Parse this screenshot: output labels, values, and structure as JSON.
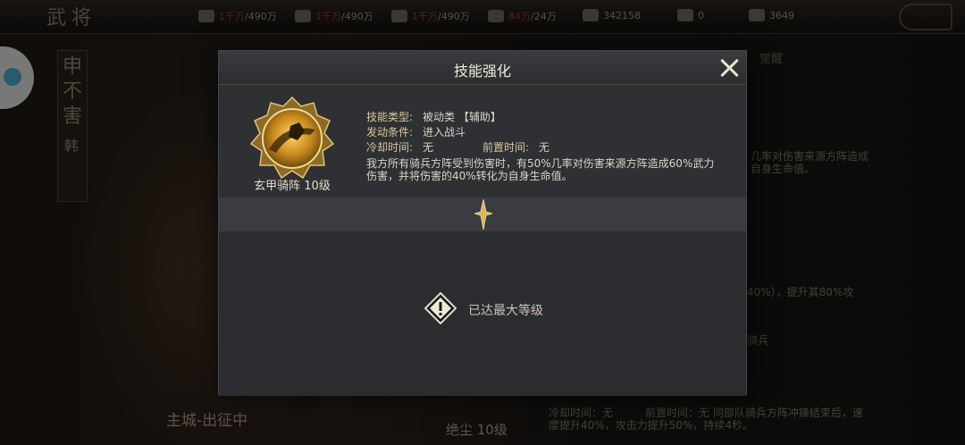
{
  "topbar": {
    "title": "武将",
    "resources": [
      {
        "icon": "grain-icon",
        "current": "1千万",
        "max": "/490万",
        "current_color": "#b0342a"
      },
      {
        "icon": "wood-icon",
        "current": "1千万",
        "max": "/490万",
        "current_color": "#b0342a"
      },
      {
        "icon": "stone-icon",
        "current": "1千万",
        "max": "/490万",
        "current_color": "#b0342a"
      },
      {
        "icon": "iron-icon",
        "current": "84万",
        "max": "/24万",
        "current_color": "#b0342a"
      },
      {
        "icon": "order-icon",
        "current": "",
        "max": "342158",
        "current_color": "#9a9488"
      },
      {
        "icon": "crown-icon",
        "current": "",
        "max": "0",
        "current_color": "#9a9488"
      },
      {
        "icon": "gold-icon",
        "current": "",
        "max": "3649",
        "current_color": "#9a9488"
      }
    ]
  },
  "background": {
    "hero_name": "申不害",
    "hero_faction": "韩",
    "city_status": "主城-出征中",
    "skill_name": "绝尘 10级",
    "right_tab": "觉醒",
    "right_text_1": "几率对伤害来源方阵造成自身生命值。",
    "right_text_2": "40%），提升其80%攻",
    "right_text_3": "骑兵",
    "bottom_right_text": "冷却时间：无　　　前置时间：无 同部队骑兵方阵冲锋结束后，速度提升40%，攻击力提升50%，持续4秒。"
  },
  "modal": {
    "title": "技能强化",
    "skill": {
      "name_level": "玄甲骑阵 10级",
      "type_label": "技能类型:",
      "type_value": "被动类 【辅助】",
      "condition_label": "发动条件:",
      "condition_value": "进入战斗",
      "cooldown_label": "冷却时间:",
      "cooldown_value": "无",
      "precast_label": "前置时间:",
      "precast_value": "无",
      "description": "我方所有骑兵方阵受到伤害时，有50%几率对伤害来源方阵造成60%武力伤害，并将伤害的40%转化为自身生命值。"
    },
    "max_level_text": "已达最大等级"
  },
  "colors": {
    "accent_gold": "#d9c79a",
    "modal_bg": "#2b2c2f",
    "resource_warning": "#b0342a"
  }
}
